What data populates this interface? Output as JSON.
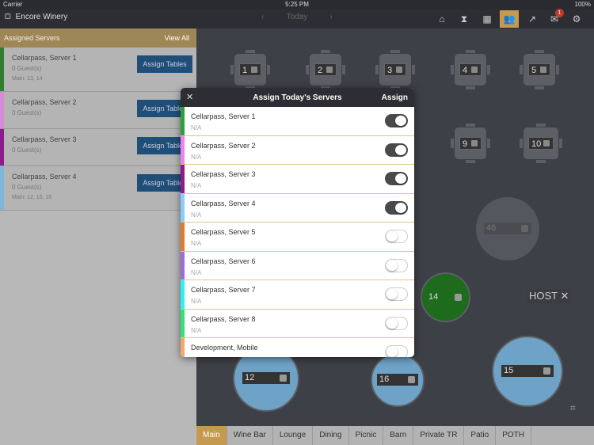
{
  "status": {
    "carrier": "Carrier",
    "time": "5:25 PM",
    "battery": "100%"
  },
  "topbar": {
    "brand": "Encore Winery",
    "date": "Today",
    "notif_count": "1"
  },
  "left": {
    "header": "Assigned Servers",
    "view_all": "View All",
    "servers": [
      {
        "name": "Cellarpass, Server 1",
        "guests": "0 Guest(s)",
        "main": "Main: 13, 14",
        "button": "Assign Tables",
        "color": "#2e7d32"
      },
      {
        "name": "Cellarpass, Server 2",
        "guests": "0 Guest(s)",
        "main": "",
        "button": "Assign Tables",
        "color": "#d98ad9"
      },
      {
        "name": "Cellarpass, Server 3",
        "guests": "0 Guest(s)",
        "main": "",
        "button": "Assign Tables",
        "color": "#8e1b8e"
      },
      {
        "name": "Cellarpass, Server 4",
        "guests": "0 Guest(s)",
        "main": "Main: 12, 15, 16",
        "button": "Assign Tables",
        "color": "#7fb6dc"
      }
    ]
  },
  "floor": {
    "tables": [
      "1",
      "2",
      "3",
      "4",
      "5",
      "9",
      "10",
      "46",
      "14",
      "12",
      "16",
      "15"
    ],
    "host": "HOST"
  },
  "tabs": [
    "Main",
    "Wine Bar",
    "Lounge",
    "Dining",
    "Picnic",
    "Barn",
    "Private TR",
    "Patio",
    "POTH"
  ],
  "modal": {
    "title": "Assign Today's Servers",
    "assign": "Assign",
    "rows": [
      {
        "name": "Cellarpass, Server 1",
        "sub": "N/A",
        "on": true,
        "color": "#2e9e3e"
      },
      {
        "name": "Cellarpass, Server 2",
        "sub": "N/A",
        "on": true,
        "color": "#ee82ee"
      },
      {
        "name": "Cellarpass, Server 3",
        "sub": "N/A",
        "on": true,
        "color": "#8e1b8e"
      },
      {
        "name": "Cellarpass, Server 4",
        "sub": "N/A",
        "on": true,
        "color": "#87cefa"
      },
      {
        "name": "Cellarpass, Server 5",
        "sub": "N/A",
        "on": false,
        "color": "#e07a2c"
      },
      {
        "name": "Cellarpass, Server 6",
        "sub": "N/A",
        "on": false,
        "color": "#9b6fd6"
      },
      {
        "name": "Cellarpass, Server 7",
        "sub": "N/A",
        "on": false,
        "color": "#2ff0f0"
      },
      {
        "name": "Cellarpass, Server 8",
        "sub": "N/A",
        "on": false,
        "color": "#33e07a"
      },
      {
        "name": "Development, Mobile",
        "sub": "",
        "on": false,
        "color": "#f2a96b"
      }
    ]
  }
}
